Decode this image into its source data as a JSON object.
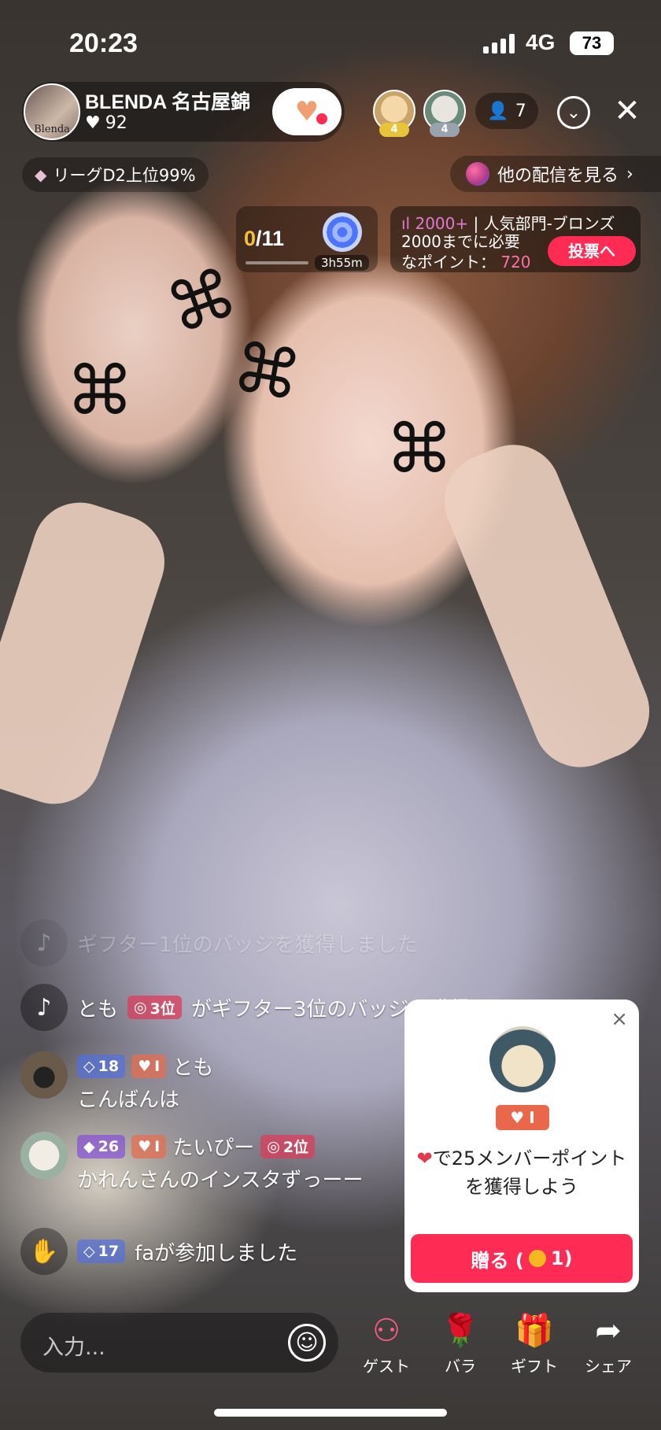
{
  "status": {
    "time": "20:23",
    "network": "4G",
    "battery": "73"
  },
  "host": {
    "name": "BLENDA 名古屋錦",
    "avatar_text": "Blenda",
    "likes": "92",
    "follow_icon": "heart-icon"
  },
  "viewers": {
    "top1_rank": "4",
    "top2_rank": "4",
    "count": "7"
  },
  "league": {
    "text": "リーグD2上位99%"
  },
  "other_streams": {
    "label": "他の配信を見る",
    "arrow": "›"
  },
  "goal": {
    "current": "0",
    "total": "/11",
    "timer": "3h55m"
  },
  "ranking": {
    "score": "2000+",
    "category": "| 人気部門-ブロンズ",
    "line1": "2000までに必要",
    "line2_prefix": "なポイント：",
    "points": "720",
    "vote_button": "投票へ"
  },
  "chat": [
    {
      "type": "system",
      "text": "ギフター1位のバッジを獲得しました"
    },
    {
      "type": "system",
      "user": "とも",
      "badge": "3位",
      "text": "がギフター3位のバッジを獲得しました"
    },
    {
      "user": "とも",
      "level": "18",
      "fan": "I",
      "message": "こんばんは"
    },
    {
      "user": "たいぴー",
      "level": "26",
      "fan": "I",
      "rank_badge": "2位",
      "message": "かれんさんのインスタずっーー"
    },
    {
      "type": "join",
      "level": "17",
      "text": "faが参加しました"
    }
  ],
  "gift_popup": {
    "close": "×",
    "badge": "I",
    "message": "で25メンバーポイントを獲得しよう",
    "send_label": "贈る (",
    "send_cost": "1)"
  },
  "input": {
    "placeholder": "入力..."
  },
  "toolbar": [
    {
      "label": "ゲスト",
      "icon": "guest-icon"
    },
    {
      "label": "バラ",
      "icon": "rose-icon"
    },
    {
      "label": "ギフト",
      "icon": "gift-icon"
    },
    {
      "label": "シェア",
      "icon": "share-icon"
    }
  ],
  "colors": {
    "accent": "#fe2c55",
    "gold": "#f3c23b",
    "points": "#ff6fa9"
  }
}
